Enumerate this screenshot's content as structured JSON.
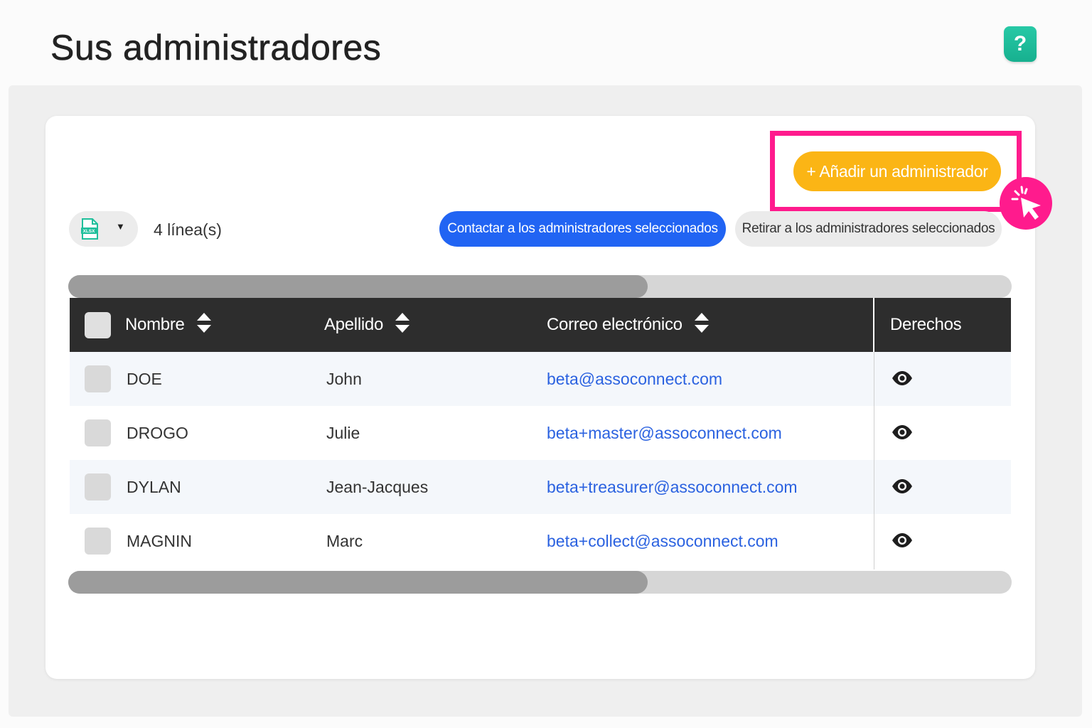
{
  "page": {
    "title": "Sus administradores",
    "help_label": "?"
  },
  "toolbar": {
    "add_admin_label": "+ Añadir un administrador",
    "export_format": "XLSX",
    "row_count": "4 línea(s)",
    "contact_label": "Contactar a los administradores seleccionados",
    "remove_label": "Retirar a los administradores seleccionados"
  },
  "table": {
    "columns": [
      "Nombre",
      "Apellido",
      "Correo electrónico",
      "Derechos"
    ],
    "rows": [
      {
        "nombre": "DOE",
        "apellido": "John",
        "email": "beta@assoconnect.com",
        "derechos": "eye-icon"
      },
      {
        "nombre": "DROGO",
        "apellido": "Julie",
        "email": "beta+master@assoconnect.com",
        "derechos": "eye-icon"
      },
      {
        "nombre": "DYLAN",
        "apellido": "Jean-Jacques",
        "email": "beta+treasurer@assoconnect.com",
        "derechos": "eye-icon"
      },
      {
        "nombre": "MAGNIN",
        "apellido": "Marc",
        "email": "beta+collect@assoconnect.com",
        "derechos": "eye-icon"
      }
    ]
  },
  "scroll": {
    "horizontal_position_fraction": 0.61
  },
  "colors": {
    "accent_yellow": "#fbb515",
    "primary_blue": "#2164f3",
    "highlight_pink": "#ff1b8d",
    "help_green": "#1fbf9b",
    "header_dark": "#2d2d2d",
    "link_blue": "#2b62e0"
  }
}
